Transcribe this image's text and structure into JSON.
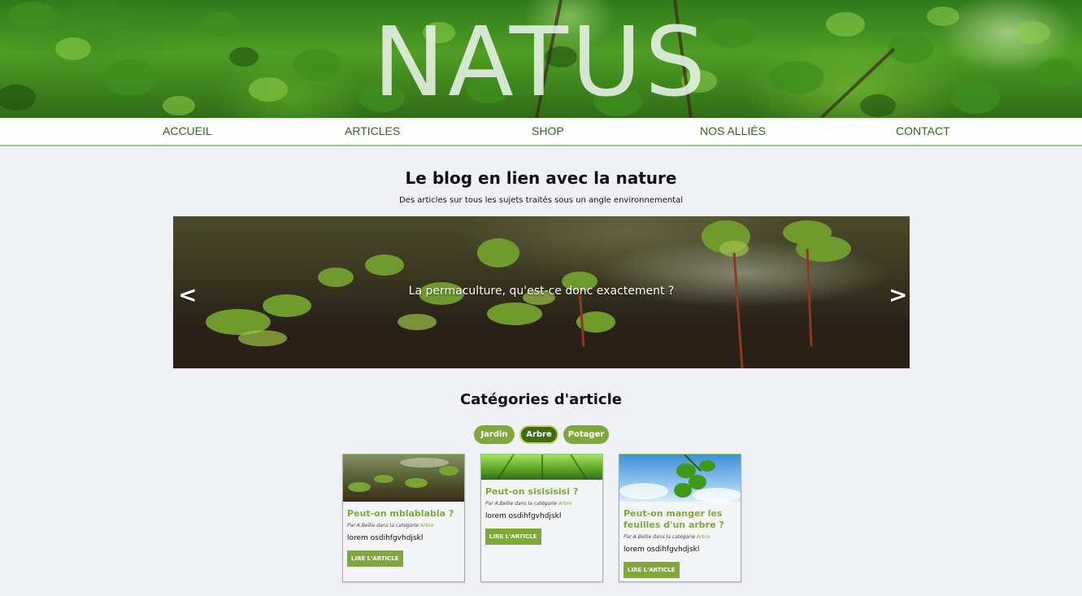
{
  "site": {
    "title": "NATUS"
  },
  "nav": {
    "items": [
      {
        "label": "ACCUEIL"
      },
      {
        "label": "ARTICLES"
      },
      {
        "label": "SHOP"
      },
      {
        "label": "NOS ALLIÉS"
      },
      {
        "label": "CONTACT"
      }
    ]
  },
  "intro": {
    "title": "Le blog en lien avec la nature",
    "subtitle": "Des articles sur tous les sujets traités sous un angle environnemental"
  },
  "carousel": {
    "caption": "La permaculture, qu'est-ce donc exactement ?",
    "prev_label": "<",
    "next_label": ">"
  },
  "categories": {
    "title": "Catégories d'article",
    "items": [
      {
        "label": "Jardin",
        "active": false
      },
      {
        "label": "Arbre",
        "active": true
      },
      {
        "label": "Potager",
        "active": false
      }
    ]
  },
  "articles": [
    {
      "title": "Peut-on mblablabla ?",
      "meta_prefix": "Par A.Bellie dans la catégorie",
      "category": "Arbre",
      "excerpt": "lorem osdihfgvhdjskl",
      "button": "LIRE L'ARTICLE"
    },
    {
      "title": "Peut-on sisisisisi ?",
      "meta_prefix": "Par A.Bellie dans la catégorie",
      "category": "Arbre",
      "excerpt": "lorem osdihfgvhdjskl",
      "button": "LIRE L'ARTICLE"
    },
    {
      "title": "Peut-on manger les feuilles d'un arbre ?",
      "meta_prefix": "Par A.Bellie dans la catégorie",
      "category": "Arbre",
      "excerpt": "lorem osdihfgvhdjskl",
      "button": "LIRE L'ARTICLE"
    }
  ],
  "colors": {
    "accent": "#7ea93a",
    "accent_dark": "#3f6b12",
    "nav_text": "#2c6b12",
    "background": "#f0f1f4"
  }
}
